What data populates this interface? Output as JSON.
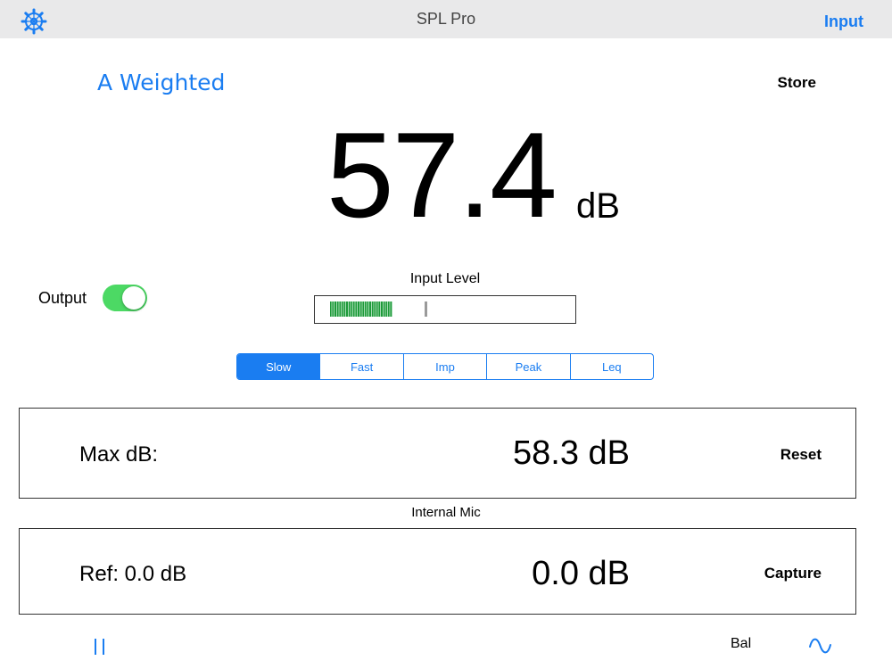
{
  "navbar": {
    "title": "SPL Pro",
    "settings_icon": "gear-icon",
    "input_label": "Input"
  },
  "weighting": "A Weighted",
  "store_label": "Store",
  "reading": {
    "value": "57.4",
    "unit": "dB"
  },
  "output": {
    "label": "Output",
    "enabled": true
  },
  "input_level": {
    "label": "Input Level",
    "level_fraction": 0.24,
    "peak_fraction": 0.42
  },
  "response_modes": {
    "options": [
      "Slow",
      "Fast",
      "Imp",
      "Peak",
      "Leq"
    ],
    "selected": "Slow"
  },
  "max": {
    "label": "Max dB:",
    "value": "58.3 dB",
    "button": "Reset"
  },
  "source": "Internal Mic",
  "ref": {
    "label": "Ref:  0.0 dB",
    "value": "0.0 dB",
    "button": "Capture"
  },
  "footer": {
    "pause_icon": "pause-icon",
    "bal_label": "Bal",
    "wave_icon": "sine-wave-icon"
  },
  "colors": {
    "accent": "#1a7df1",
    "toggle_on": "#4cd964",
    "meter_fill": "#1e9a3a",
    "navbar_bg": "#e9e9ea"
  }
}
